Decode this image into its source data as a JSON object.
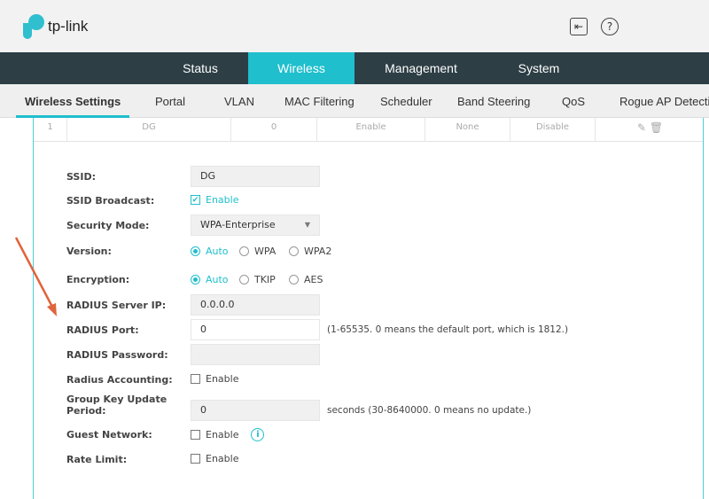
{
  "header": {
    "brand": "tp-link",
    "logout_icon": "logout-icon",
    "help_icon": "help-icon"
  },
  "nav": {
    "tabs": [
      "Status",
      "Wireless",
      "Management",
      "System"
    ],
    "active": "Wireless",
    "accent": "#1fbfcd"
  },
  "subnav": {
    "tabs": [
      "Wireless Settings",
      "Portal",
      "VLAN",
      "MAC Filtering",
      "Scheduler",
      "Band Steering",
      "QoS",
      "Rogue AP Detection"
    ],
    "active": "Wireless Settings"
  },
  "table_row": {
    "cells": [
      "1",
      "DG",
      "0",
      "Enable",
      "None",
      "Disable"
    ]
  },
  "form": {
    "ssid": {
      "label": "SSID:",
      "value": "DG"
    },
    "ssid_broadcast": {
      "label": "SSID Broadcast:",
      "option": "Enable",
      "checked": true
    },
    "security_mode": {
      "label": "Security Mode:",
      "value": "WPA-Enterprise"
    },
    "version": {
      "label": "Version:",
      "options": [
        "Auto",
        "WPA",
        "WPA2"
      ],
      "selected": "Auto"
    },
    "encryption": {
      "label": "Encryption:",
      "options": [
        "Auto",
        "TKIP",
        "AES"
      ],
      "selected": "Auto"
    },
    "radius_ip": {
      "label": "RADIUS Server IP:",
      "value": "0.0.0.0"
    },
    "radius_port": {
      "label": "RADIUS Port:",
      "value": "0",
      "hint": "(1-65535. 0 means the default port, which is 1812.)"
    },
    "radius_password": {
      "label": "RADIUS Password:",
      "value": ""
    },
    "radius_accounting": {
      "label": "Radius Accounting:",
      "option": "Enable",
      "checked": false
    },
    "group_key": {
      "label_line1": "Group Key Update",
      "label_line2": "Period:",
      "value": "0",
      "hint": "seconds (30-8640000. 0 means no update.)"
    },
    "guest_network": {
      "label": "Guest Network:",
      "option": "Enable",
      "checked": false
    },
    "rate_limit": {
      "label": "Rate Limit:",
      "option": "Enable",
      "checked": false
    }
  },
  "annotation": {
    "color": "#e0643c"
  }
}
